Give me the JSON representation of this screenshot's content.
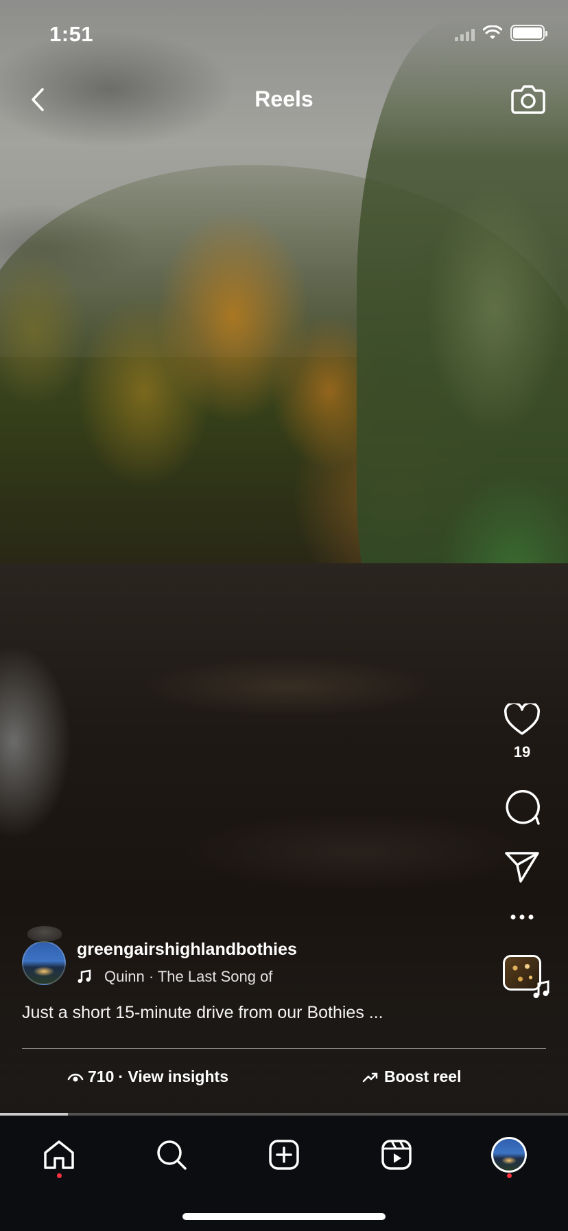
{
  "status_bar": {
    "time": "1:51"
  },
  "header": {
    "title": "Reels"
  },
  "reel": {
    "likes_count": "19",
    "author": {
      "username": "greengairshighlandbothies"
    },
    "audio": {
      "label": "Quinn · The Last Song of"
    },
    "caption": "Just a short 15-minute drive from our Bothies ...",
    "insights": {
      "views": "710",
      "label": "· View insights"
    },
    "boost_label": "Boost reel",
    "playback_progress": 0.12
  },
  "icons": {
    "back": "chevron-left-icon",
    "camera": "camera-icon",
    "like": "heart-icon",
    "comment": "comment-bubble-icon",
    "share": "paper-plane-icon",
    "more": "more-dots-icon",
    "views": "eye-icon",
    "boost": "trending-up-icon",
    "home": "home-icon",
    "search": "search-icon",
    "create": "plus-square-icon",
    "reels": "reels-icon"
  },
  "colors": {
    "notification_dot": "#ff3040",
    "nav_background": "#0c0d10"
  }
}
